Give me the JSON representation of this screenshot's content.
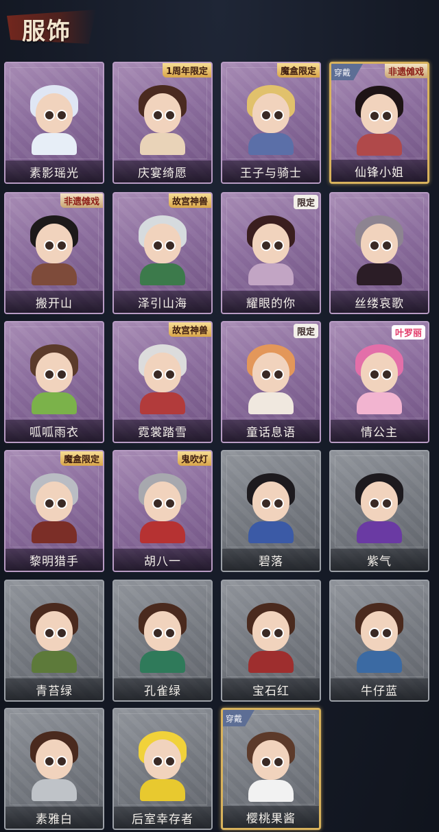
{
  "page": {
    "title": "服饰"
  },
  "cards": [
    {
      "name": "素影瑶光",
      "theme": "purple",
      "hair": "#dfe6f4",
      "outfit": "#e7eef7",
      "badge": "",
      "badge_style": ""
    },
    {
      "name": "庆宴绮愿",
      "theme": "purple",
      "hair": "#4a2a20",
      "outfit": "#e9d3b8",
      "badge": "1周年限定",
      "badge_style": "gold"
    },
    {
      "name": "王子与骑士",
      "theme": "purple",
      "hair": "#e1c16c",
      "outfit": "#5b6fa8",
      "badge": "魔盒限定",
      "badge_style": "gold"
    },
    {
      "name": "仙锋小姐",
      "theme": "purple",
      "hair": "#1e1416",
      "outfit": "#b0494a",
      "badge": "非遗傩戏",
      "badge_style": "red",
      "worn": true,
      "worn_label": "穿戴"
    },
    {
      "name": "搬开山",
      "theme": "purple",
      "hair": "#1d1a1a",
      "outfit": "#7e4b3a",
      "badge": "非遗傩戏",
      "badge_style": "red"
    },
    {
      "name": "泽引山海",
      "theme": "purple",
      "hair": "#d6dbde",
      "outfit": "#3c7a4b",
      "badge": "故宫神兽",
      "badge_style": "gold"
    },
    {
      "name": "耀眼的你",
      "theme": "purple",
      "hair": "#3a1e1f",
      "outfit": "#c2a5c4",
      "badge": "限定",
      "badge_style": "white"
    },
    {
      "name": "丝缕哀歌",
      "theme": "purple",
      "hair": "#8d8491",
      "outfit": "#2b1d26",
      "badge": "",
      "badge_style": ""
    },
    {
      "name": "呱呱雨衣",
      "theme": "purple",
      "hair": "#5b3b2b",
      "outfit": "#7bb24a",
      "badge": "",
      "badge_style": ""
    },
    {
      "name": "霓裳踏雪",
      "theme": "purple",
      "hair": "#dcdcdc",
      "outfit": "#b23b3b",
      "badge": "故宫神兽",
      "badge_style": "gold"
    },
    {
      "name": "童话息语",
      "theme": "purple",
      "hair": "#e3975a",
      "outfit": "#f0e8df",
      "badge": "限定",
      "badge_style": "white"
    },
    {
      "name": "情公主",
      "theme": "purple",
      "hair": "#e36fa9",
      "outfit": "#f2b4d0",
      "badge": "叶罗丽",
      "badge_style": "pink"
    },
    {
      "name": "黎明猎手",
      "theme": "purple",
      "hair": "#b9bcc3",
      "outfit": "#7b2e27",
      "badge": "魔盒限定",
      "badge_style": "gold"
    },
    {
      "name": "胡八一",
      "theme": "purple",
      "hair": "#a7a8ae",
      "outfit": "#b63232",
      "badge": "鬼吹灯",
      "badge_style": "gold"
    },
    {
      "name": "碧落",
      "theme": "gray",
      "hair": "#1d1a1e",
      "outfit": "#3b5aa6",
      "badge": "",
      "badge_style": ""
    },
    {
      "name": "紫气",
      "theme": "gray",
      "hair": "#1d1a1e",
      "outfit": "#6a3aa3",
      "badge": "",
      "badge_style": ""
    },
    {
      "name": "青苔绿",
      "theme": "gray",
      "hair": "#4a2a1e",
      "outfit": "#5d7a3a",
      "badge": "",
      "badge_style": ""
    },
    {
      "name": "孔雀绿",
      "theme": "gray",
      "hair": "#4a2a1e",
      "outfit": "#2f7a5a",
      "badge": "",
      "badge_style": ""
    },
    {
      "name": "宝石红",
      "theme": "gray",
      "hair": "#4a2a1e",
      "outfit": "#9e2e2e",
      "badge": "",
      "badge_style": ""
    },
    {
      "name": "牛仔蓝",
      "theme": "gray",
      "hair": "#4a2a1e",
      "outfit": "#3b6aa3",
      "badge": "",
      "badge_style": ""
    },
    {
      "name": "素雅白",
      "theme": "gray",
      "hair": "#4a2a1e",
      "outfit": "#bfc3c8",
      "badge": "",
      "badge_style": ""
    },
    {
      "name": "后室幸存者",
      "theme": "gray",
      "hair": "#f1d23a",
      "outfit": "#e8c92f",
      "badge": "",
      "badge_style": ""
    },
    {
      "name": "樱桃果酱",
      "theme": "gray",
      "hair": "#5c3a2a",
      "outfit": "#f2f2f2",
      "badge": "",
      "badge_style": "",
      "worn": true,
      "worn_label": "穿戴"
    }
  ]
}
